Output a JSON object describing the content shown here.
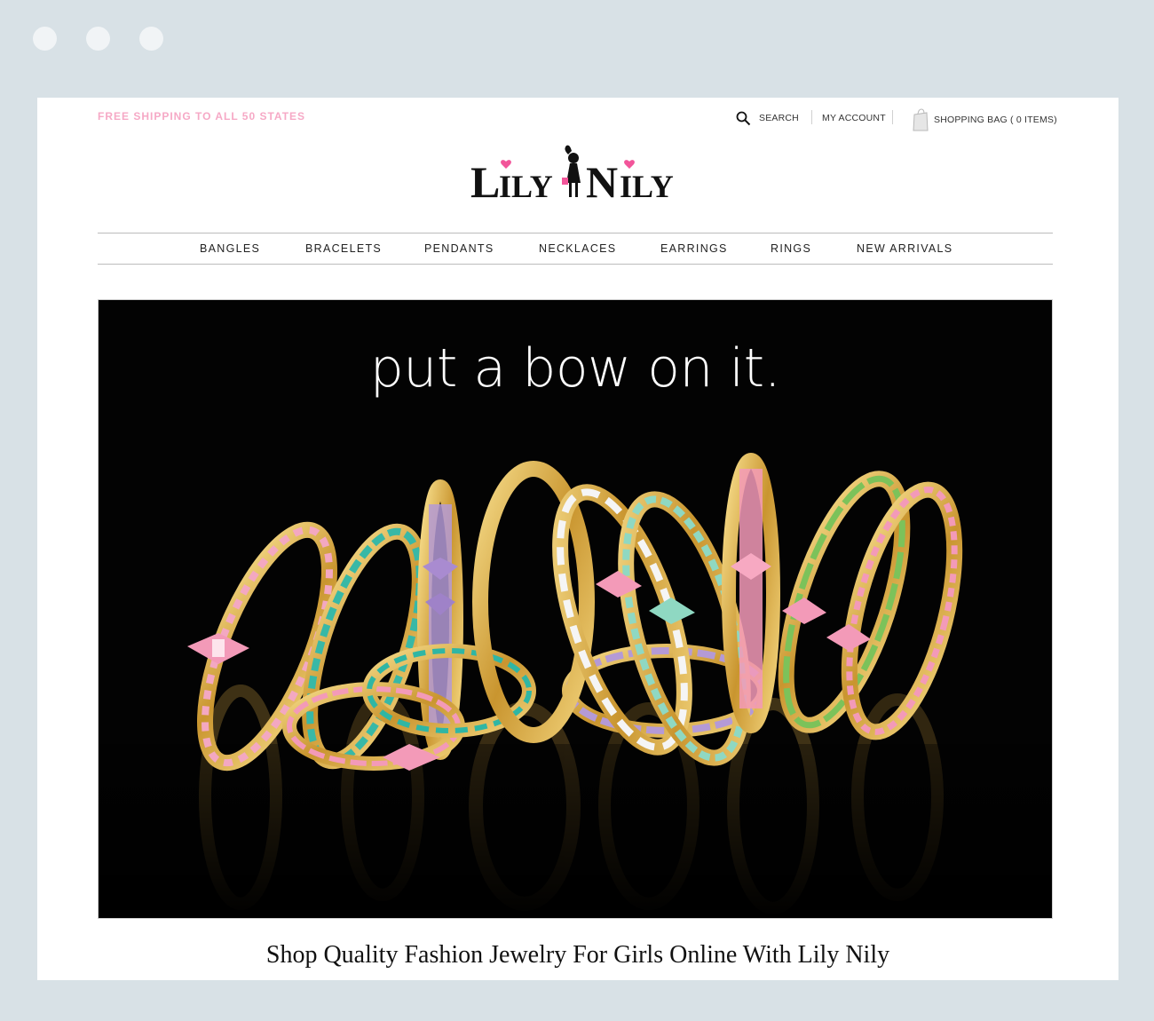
{
  "header": {
    "promo": "FREE SHIPPING TO ALL 50 STATES",
    "search_label": "SEARCH",
    "account_label": "MY ACCOUNT",
    "bag_label": "SHOPPING BAG ( 0 ITEMS)",
    "logo_text": "LilyNily"
  },
  "nav": {
    "items": [
      "BANGLES",
      "BRACELETS",
      "PENDANTS",
      "NECKLACES",
      "EARRINGS",
      "RINGS",
      "NEW ARRIVALS"
    ]
  },
  "hero": {
    "headline": "put a bow on it."
  },
  "tagline": "Shop Quality Fashion Jewelry For Girls Online With Lily Nily",
  "colors": {
    "promo": "#f6a9c6",
    "hero_bg": "#030303",
    "gold": "#d9b04e",
    "pink": "#f39ab8",
    "mint": "#8fd8c2",
    "lavender": "#b49ad6",
    "teal": "#2fb6a4",
    "green": "#7cc25a"
  },
  "icons": {
    "search": "search-icon",
    "bag": "shopping-bag-icon"
  }
}
